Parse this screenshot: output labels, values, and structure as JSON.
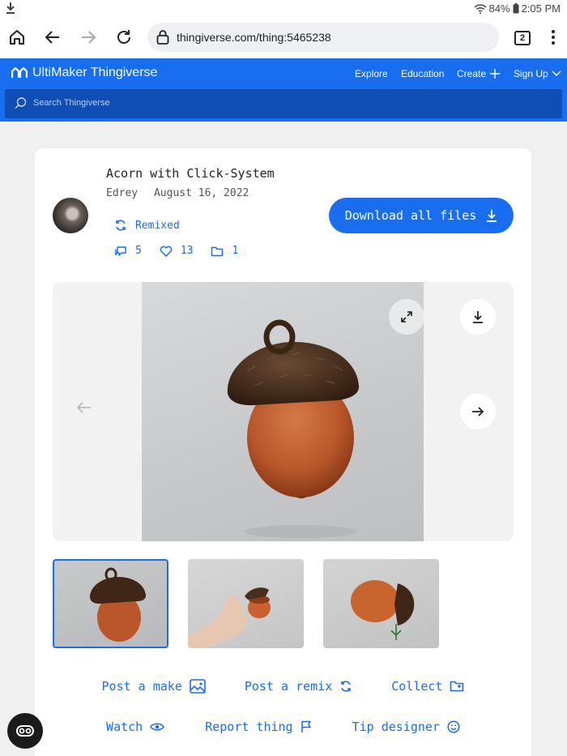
{
  "status_bar": {
    "battery": "84%",
    "time": "2:05 PM"
  },
  "browser": {
    "url": "thingiverse.com/thing:5465238",
    "tab_count": "2"
  },
  "site": {
    "brand": "UltiMaker Thingiverse",
    "nav": [
      {
        "label": "Explore"
      },
      {
        "label": "Education"
      },
      {
        "label": "Create"
      },
      {
        "label": "Sign Up"
      }
    ],
    "search_placeholder": "Search Thingiverse"
  },
  "thing": {
    "title": "Acorn with Click-System",
    "author": "Edrey",
    "date": "August 16, 2022",
    "remixed_label": "Remixed",
    "stats": {
      "comments": "5",
      "likes": "13",
      "collections": "1"
    },
    "download_label": "Download all files"
  },
  "actions_row1": [
    {
      "label": "Post a make"
    },
    {
      "label": "Post a remix"
    },
    {
      "label": "Collect"
    }
  ],
  "actions_row2": [
    {
      "label": "Watch"
    },
    {
      "label": "Report thing"
    },
    {
      "label": "Tip designer"
    }
  ],
  "colors": {
    "brand_blue": "#196ef0",
    "search_blue": "#0f4fb5",
    "acorn_body": "#b9572a",
    "acorn_cap": "#4a2e1c"
  }
}
